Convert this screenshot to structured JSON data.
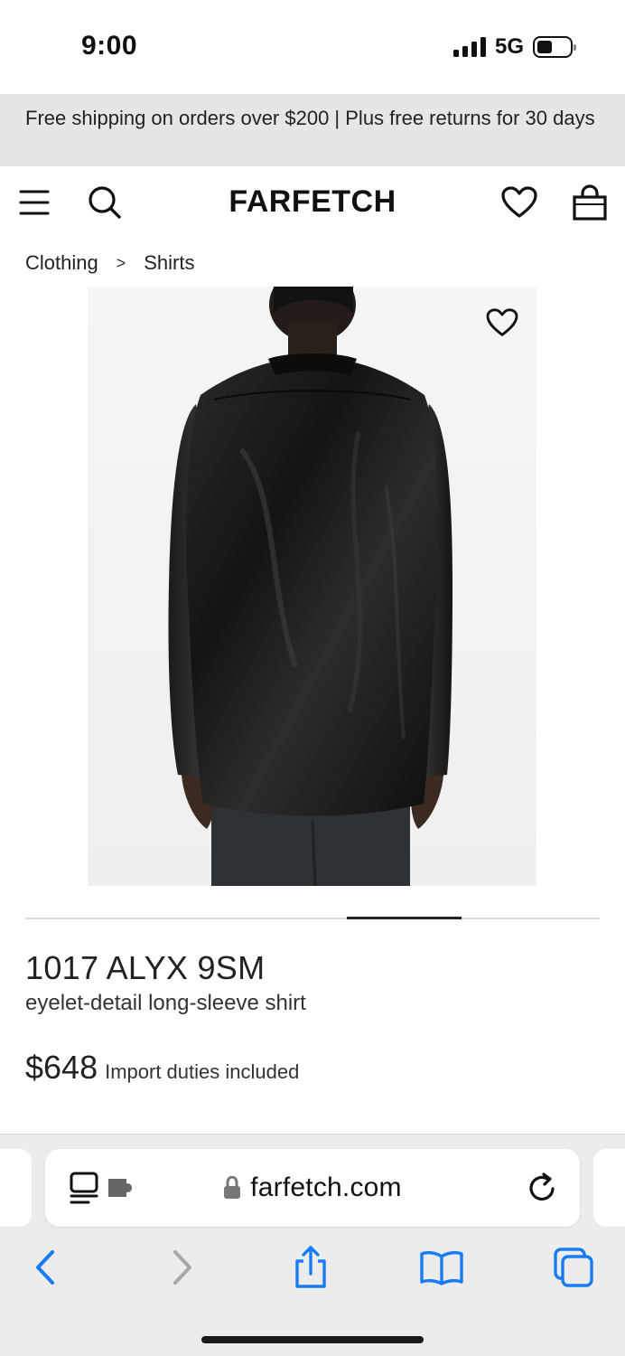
{
  "status_bar": {
    "time": "9:00",
    "network": "5G",
    "icons": [
      "signal-icon",
      "battery-icon"
    ]
  },
  "promo": {
    "text": "Free shipping on orders over $200 | Plus free returns for 30 days"
  },
  "header": {
    "logo": "FARFETCH",
    "icons": [
      "menu-icon",
      "search-icon",
      "heart-icon",
      "bag-icon"
    ]
  },
  "breadcrumb": {
    "items": [
      "Clothing",
      "Shirts"
    ],
    "separator": ">"
  },
  "product": {
    "brand": "1017 ALYX 9SM",
    "description": "eyelet-detail long-sleeve shirt",
    "price": "$648",
    "price_note": "Import duties included",
    "image": "black satin shirt worn by model, back view",
    "carousel_position": 0.7
  },
  "browser": {
    "url": "farfetch.com",
    "toolbar_icons": [
      "back-icon",
      "forward-icon",
      "share-icon",
      "bookmarks-icon",
      "tabs-icon"
    ]
  },
  "colors": {
    "accent": "#1a7cf5",
    "banner_bg": "#e6e6e6",
    "text": "#222222"
  }
}
